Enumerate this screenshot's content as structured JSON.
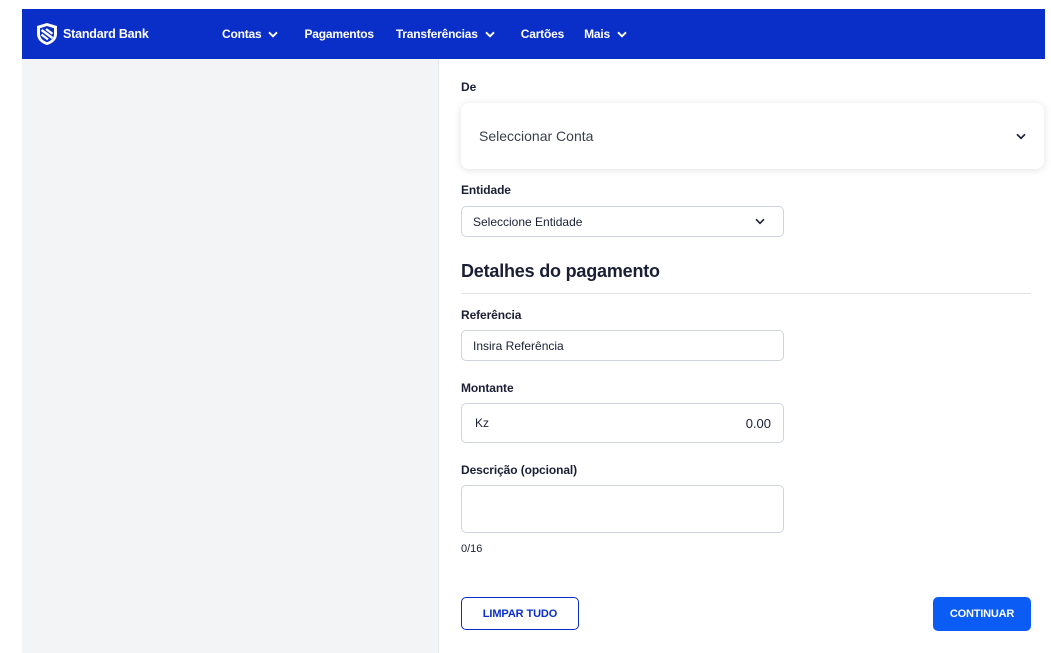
{
  "brand": {
    "name": "Standard Bank",
    "logo_icon": "shield-logo-icon"
  },
  "nav": {
    "items": [
      {
        "label": "Contas",
        "has_dropdown": true
      },
      {
        "label": "Pagamentos",
        "has_dropdown": false
      },
      {
        "label": "Transferências",
        "has_dropdown": true
      },
      {
        "label": "Cartões",
        "has_dropdown": false
      },
      {
        "label": "Mais",
        "has_dropdown": true
      }
    ]
  },
  "form": {
    "from_label": "De",
    "account_select": {
      "value": "Seleccionar Conta"
    },
    "entity_label": "Entidade",
    "entity_select": {
      "value": "Seleccione Entidade"
    },
    "section_title": "Detalhes do pagamento",
    "reference_label": "Referência",
    "reference_placeholder": "Insira Referência",
    "amount_label": "Montante",
    "amount_currency": "Kz",
    "amount_value": "0.00",
    "description_label": "Descrição (opcional)",
    "description_counter": "0/16"
  },
  "actions": {
    "clear_label": "LIMPAR TUDO",
    "continue_label": "CONTINUAR"
  },
  "colors": {
    "topbar": "#0a2fc8",
    "primary_button": "#0a5cf5",
    "left_panel": "#f3f4f5"
  }
}
